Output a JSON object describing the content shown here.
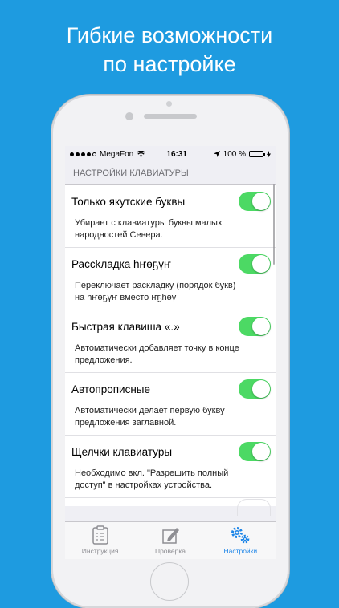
{
  "headline": {
    "line1": "Гибкие возможности",
    "line2": "по настройке"
  },
  "status_bar": {
    "carrier": "MegaFon",
    "time": "16:31",
    "battery": "100 %",
    "signal_bars_filled": 4,
    "signal_bars_total": 5
  },
  "settings": {
    "section_header": "НАСТРОЙКИ КЛАВИАТУРЫ",
    "items": [
      {
        "label": "Только якутские буквы",
        "description_line1": "Убирает с клавиатуры буквы малых",
        "description_line2": "народностей Севера.",
        "enabled": true
      },
      {
        "label": "Рассkладка һҥөҕүҥ",
        "description_line1": "Переключает раскладку (порядок букв)",
        "description_line2": "на һҥөҕүҥ вместо ҥҕһөү",
        "enabled": true
      },
      {
        "label": "Быстрая клавиша «.»",
        "description_line1": "Автоматически добавляет точку в конце",
        "description_line2": "предложения.",
        "enabled": true
      },
      {
        "label": "Автопрописные",
        "description_line1": "Автоматически делает первую букву",
        "description_line2": "предложения заглавной.",
        "enabled": true
      },
      {
        "label": "Щелчки клавиатуры",
        "description_line1": "Необходимо вкл. \"Разрешить полный",
        "description_line2": "доступ\" в настройках устройства.",
        "enabled": true
      }
    ]
  },
  "tab_bar": {
    "tabs": [
      {
        "label": "Инструкция",
        "icon": "clipboard-icon",
        "active": false
      },
      {
        "label": "Проверка",
        "icon": "pencil-icon",
        "active": false
      },
      {
        "label": "Настройки",
        "icon": "gears-icon",
        "active": true
      }
    ]
  },
  "colors": {
    "background": "#1e9be0",
    "toggle_on": "#4cd964",
    "tab_active": "#1e86e8",
    "tab_inactive": "#8e8e93"
  }
}
